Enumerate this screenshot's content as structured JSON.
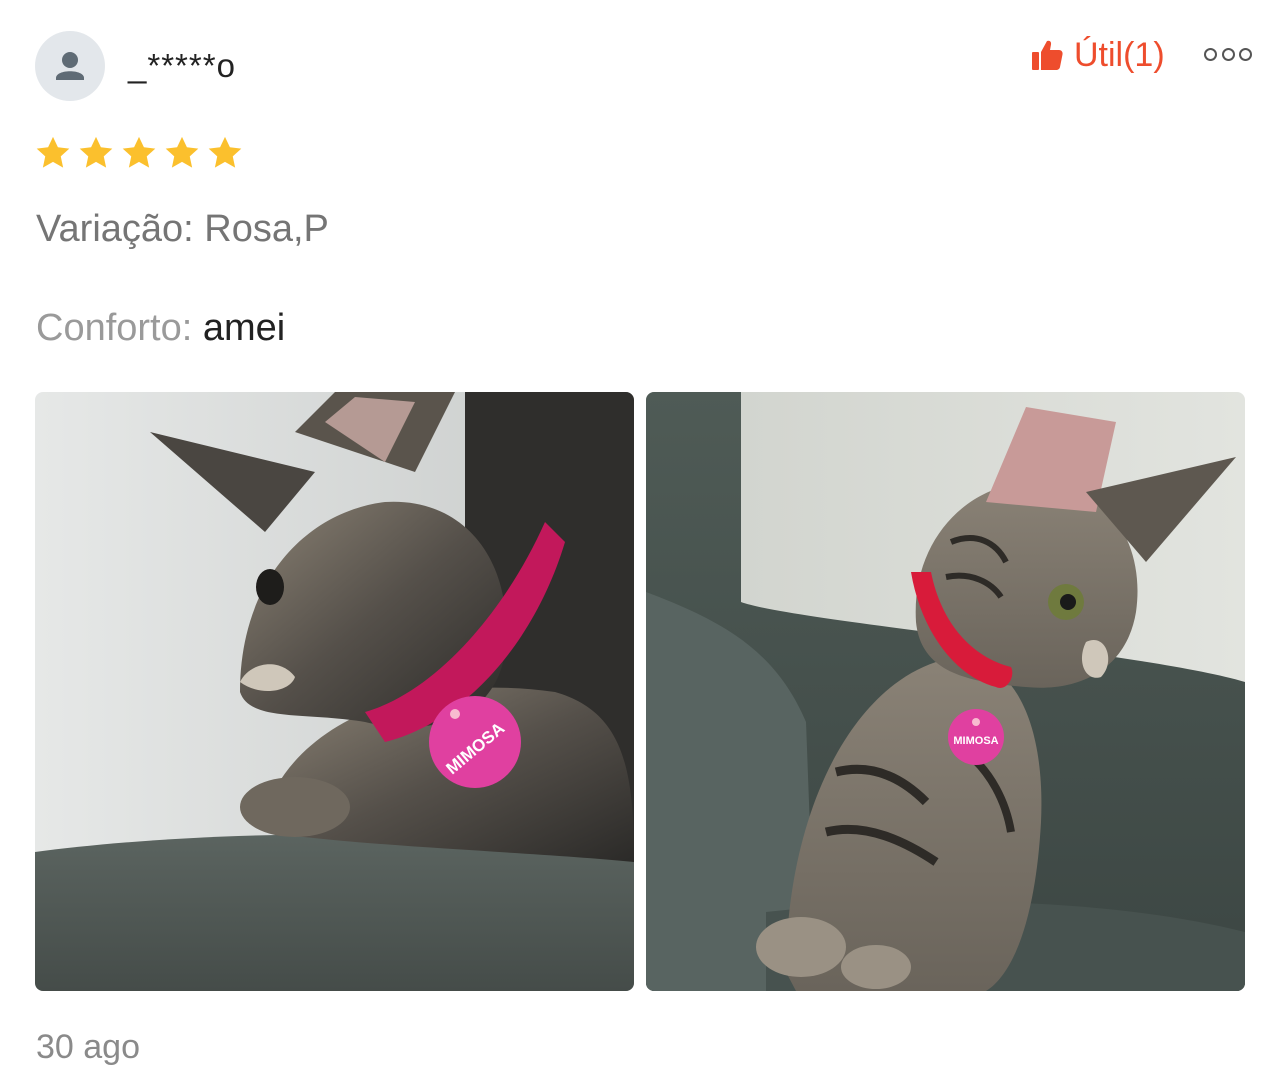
{
  "review": {
    "username": "_*****o",
    "rating": 5,
    "rating_max": 5,
    "helpful_label": "Útil(1)",
    "variation": "Variação: Rosa,P",
    "attribute": {
      "label": "Conforto: ",
      "value": "amei"
    },
    "date": "30 ago",
    "photos": [
      {
        "name": "review-photo-1",
        "tag_text": "MIMOSA"
      },
      {
        "name": "review-photo-2",
        "tag_text": "MIMOSA"
      }
    ]
  },
  "icons": {
    "avatar": "user-icon",
    "helpful": "thumbs-up-icon",
    "more": "more-options-icon",
    "star": "star-icon"
  },
  "colors": {
    "accent": "#ee4d2d",
    "star": "#fbc02d",
    "secondary_text": "#757575"
  }
}
